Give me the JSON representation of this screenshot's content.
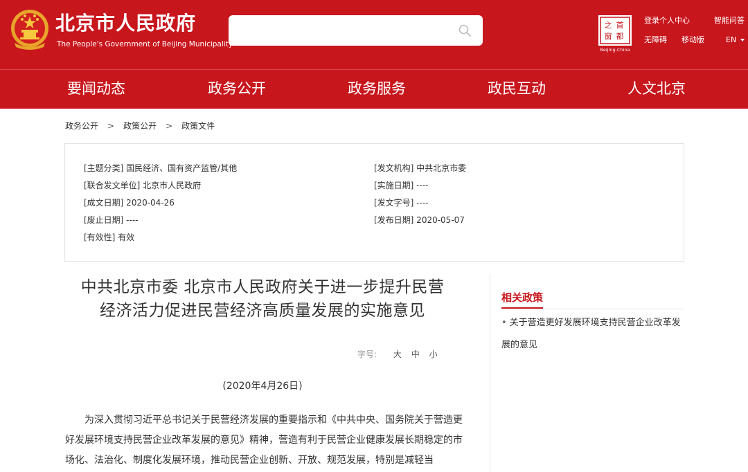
{
  "header": {
    "title": "北京市人民政府",
    "subtitle": "The People's Government of Beijing Municipality",
    "search_placeholder": "",
    "top_links": [
      "登录个人中心",
      "智能问答",
      "无障碍",
      "移动版"
    ],
    "language": "EN",
    "capital_logo_text": "Beijing-China",
    "capital_logo_chars": [
      "首",
      "都",
      "之",
      "窗"
    ],
    "brand_color": "#c8161d"
  },
  "nav": {
    "items": [
      "要闻动态",
      "政务公开",
      "政务服务",
      "政民互动",
      "人文北京"
    ]
  },
  "breadcrumb": [
    "政务公开",
    "政策公开",
    "政策文件"
  ],
  "breadcrumb_separator": ">",
  "meta": {
    "topic": "[主题分类] 国民经济、国有资产监管/其他",
    "issuer": "[发文机构] 中共北京市委",
    "co_issuer": "[联合发文单位] 北京市人民政府",
    "effective_date": "[实施日期] ----",
    "written_date": "[成文日期] 2020-04-26",
    "doc_number": "[发文字号] ----",
    "expiry_date": "[废止日期] ----",
    "publish_date": "[发布日期] 2020-05-07",
    "validity": "[有效性] 有效"
  },
  "article": {
    "title_line1": "中共北京市委 北京市人民政府关于进一步提升民营",
    "title_line2": "经济活力促进民营经济高质量发展的实施意见",
    "font_size_label": "字号:",
    "font_sizes": [
      "大",
      "中",
      "小"
    ],
    "date": "(2020年4月26日)",
    "body": "为深入贯彻习近平总书记关于民营经济发展的重要指示和《中共中央、国务院关于营造更好发展环境支持民营企业改革发展的意见》精神，营造有利于民营企业健康发展长期稳定的市场化、法治化、制度化发展环境，推动民营企业创新、开放、规范发展，特别是减轻当"
  },
  "related": {
    "title": "相关政策",
    "items": [
      "关于营造更好发展环境支持民营企业改革发展的意见"
    ]
  }
}
